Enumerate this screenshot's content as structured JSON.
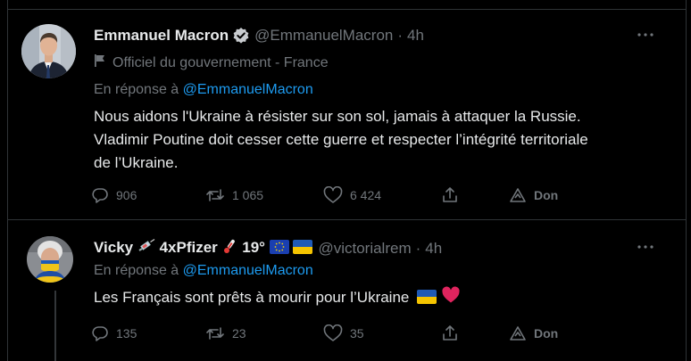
{
  "tweets": [
    {
      "display_name": "Emmanuel Macron",
      "verified": true,
      "handle": "@EmmanuelMacron",
      "separator": "·",
      "time": "4h",
      "affiliation": "Officiel du gouvernement - France",
      "reply_prefix": "En réponse à",
      "reply_to": "@EmmanuelMacron",
      "text_lines": [
        "Nous aidons l'Ukraine à résister sur son sol, jamais à attaquer la Russie.",
        "Vladimir Poutine doit cesser cette guerre et respecter l’intégrité territoriale",
        "de l’Ukraine."
      ],
      "stats": {
        "replies": "906",
        "retweets": "1 065",
        "likes": "6 424",
        "tip_label": "Don"
      }
    },
    {
      "display_name_prefix": "Vicky",
      "display_name_mid": "4xPfizer",
      "display_name_suffix": "19°",
      "handle": "@victorialrem",
      "separator": "·",
      "time": "4h",
      "reply_prefix": "En réponse à",
      "reply_to": "@EmmanuelMacron",
      "text": "Les Français sont prêts à mourir pour l’Ukraine",
      "stats": {
        "replies": "135",
        "retweets": "23",
        "likes": "35",
        "tip_label": "Don"
      }
    }
  ],
  "icons": {
    "more": "more-horizontal-icon",
    "reply": "reply-icon",
    "retweet": "retweet-icon",
    "like": "heart-icon",
    "share": "share-icon",
    "tip": "tip-icon",
    "flag": "flag-icon",
    "verified": "verified-badge-icon"
  },
  "colors": {
    "background": "#000000",
    "text": "#e7e9ea",
    "muted": "#71767b",
    "link": "#1d9bf0",
    "border": "#2f3336"
  }
}
